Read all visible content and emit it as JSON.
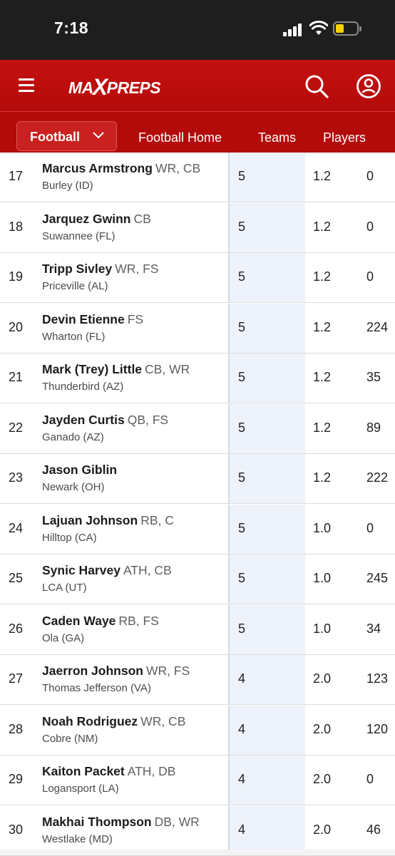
{
  "status_bar": {
    "time": "7:18"
  },
  "header": {
    "logo_text_left": "MA",
    "logo_text_x": "X",
    "logo_text_right": "PREPS"
  },
  "nav": {
    "sport": "Football",
    "links": [
      "Football Home",
      "Teams",
      "Players"
    ]
  },
  "colors": {
    "brand_red": "#c41010",
    "highlight_column": "#eef2fa"
  },
  "rows": [
    {
      "rank": "17",
      "name": "Marcus Armstrong",
      "position": "WR, CB",
      "school": "Burley (ID)",
      "c1": "5",
      "c2": "1.2",
      "c3": "0"
    },
    {
      "rank": "18",
      "name": "Jarquez Gwinn",
      "position": "CB",
      "school": "Suwannee (FL)",
      "c1": "5",
      "c2": "1.2",
      "c3": "0"
    },
    {
      "rank": "19",
      "name": "Tripp Sivley",
      "position": "WR, FS",
      "school": "Priceville (AL)",
      "c1": "5",
      "c2": "1.2",
      "c3": "0"
    },
    {
      "rank": "20",
      "name": "Devin Etienne",
      "position": "FS",
      "school": "Wharton (FL)",
      "c1": "5",
      "c2": "1.2",
      "c3": "224"
    },
    {
      "rank": "21",
      "name": "Mark (Trey) Little",
      "position": "CB, WR",
      "school": "Thunderbird (AZ)",
      "c1": "5",
      "c2": "1.2",
      "c3": "35"
    },
    {
      "rank": "22",
      "name": "Jayden Curtis",
      "position": "QB, FS",
      "school": "Ganado (AZ)",
      "c1": "5",
      "c2": "1.2",
      "c3": "89"
    },
    {
      "rank": "23",
      "name": "Jason Giblin",
      "position": "",
      "school": "Newark (OH)",
      "c1": "5",
      "c2": "1.2",
      "c3": "222"
    },
    {
      "rank": "24",
      "name": "Lajuan Johnson",
      "position": "RB, C",
      "school": "Hilltop (CA)",
      "c1": "5",
      "c2": "1.0",
      "c3": "0"
    },
    {
      "rank": "25",
      "name": "Synic Harvey",
      "position": "ATH, CB",
      "school": "LCA (UT)",
      "c1": "5",
      "c2": "1.0",
      "c3": "245"
    },
    {
      "rank": "26",
      "name": "Caden Waye",
      "position": "RB, FS",
      "school": "Ola (GA)",
      "c1": "5",
      "c2": "1.0",
      "c3": "34"
    },
    {
      "rank": "27",
      "name": "Jaerron Johnson",
      "position": "WR, FS",
      "school": "Thomas Jefferson (VA)",
      "c1": "4",
      "c2": "2.0",
      "c3": "123"
    },
    {
      "rank": "28",
      "name": "Noah Rodriguez",
      "position": "WR, CB",
      "school": "Cobre (NM)",
      "c1": "4",
      "c2": "2.0",
      "c3": "120"
    },
    {
      "rank": "29",
      "name": "Kaiton Packet",
      "position": "ATH, DB",
      "school": "Logansport (LA)",
      "c1": "4",
      "c2": "2.0",
      "c3": "0"
    },
    {
      "rank": "30",
      "name": "Makhai Thompson",
      "position": "DB, WR",
      "school": "Westlake (MD)",
      "c1": "4",
      "c2": "2.0",
      "c3": "46"
    }
  ]
}
